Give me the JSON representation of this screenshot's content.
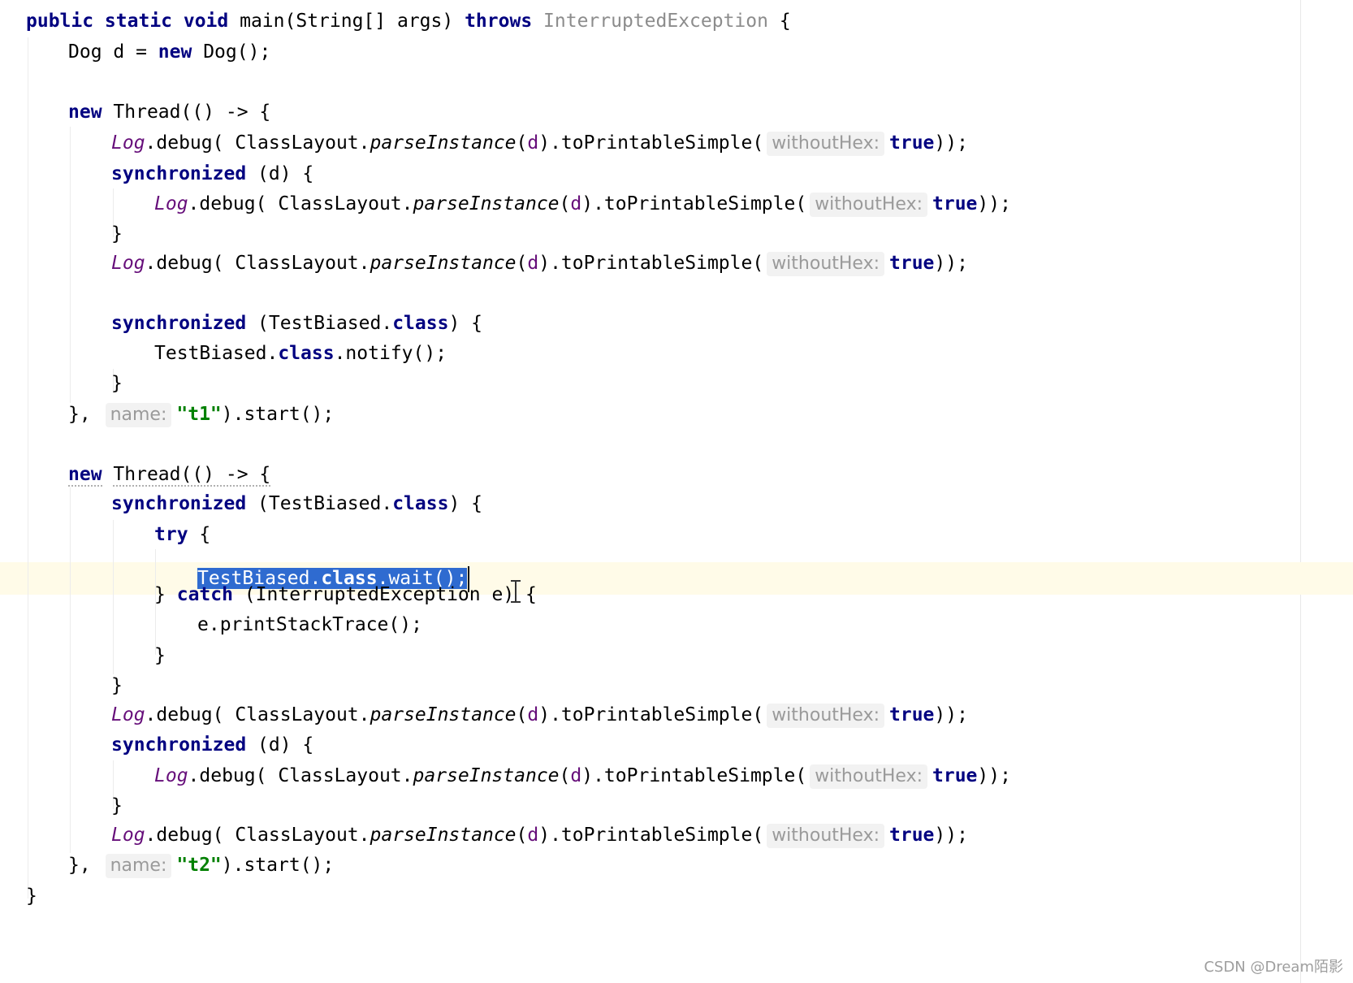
{
  "editor": {
    "language": "java",
    "colors": {
      "keyword": "#000080",
      "string": "#008000",
      "static_field": "#660e7a",
      "hint_text": "#9a9a9a",
      "selection": "#2f6bd0",
      "caret_row": "#fffbe8"
    },
    "code": {
      "l1_kw": "public static void",
      "l1_sig": "main(String[] args)",
      "l1_throws": "throws",
      "l1_exc": "InterruptedException",
      "dog_type": "Dog d =",
      "new": "new",
      "dog_ctor": "Dog();",
      "thread_open": "Thread(() -> {",
      "log": "Log",
      "debug_call": ".debug( ClassLayout.",
      "parse": "parseInstance",
      "d": "d",
      "printable": ").toPrintableSimple(",
      "hint_without_hex": "withoutHex:",
      "true_kw": "true",
      "close_call": "));",
      "paren_open": "(",
      "synchronized": "synchronized",
      "sync_d": "(d) {",
      "brace_close": "}",
      "sync_class_a": "(TestBiased.",
      "class_kw": "class",
      "sync_class_b": ") {",
      "notify_a": "TestBiased.",
      "notify_b": ".notify();",
      "thread_close": "},",
      "hint_name": "name:",
      "t1": "\"t1\"",
      "t2": "\"t2\"",
      "start": ").start();",
      "try": "try",
      "open_brace": "{",
      "wait_a": "TestBiased.",
      "wait_b": ".wait();",
      "catch_close": "}",
      "catch": "catch",
      "catch_rest": "(InterruptedException e) {",
      "print_stack": "e.printStackTrace();"
    }
  },
  "watermark": "CSDN @Dream陌影"
}
